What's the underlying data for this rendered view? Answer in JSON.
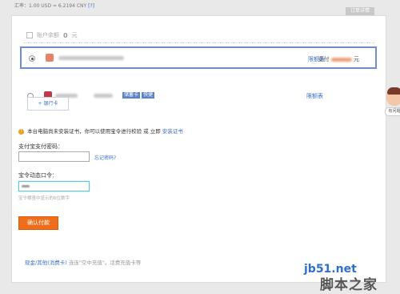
{
  "header": {
    "rate_text": "汇率：1.00 USD = 6.2194 CNY",
    "rate_help": "[?]",
    "order_tab": "订单详情"
  },
  "balance": {
    "label": "账户余额",
    "amount": "0",
    "unit": "元"
  },
  "methods": [
    {
      "selected": true,
      "action": "限额表",
      "pay_label": "支付",
      "pay_unit": "元"
    },
    {
      "selected": false,
      "tags": [
        "储蓄卡",
        "快捷"
      ],
      "action": "限额表"
    }
  ],
  "add_card_label": "+ 银行卡",
  "warning": {
    "text": "本台电脑尚未安装证书，你可以使用宝令进行校验 或 立即",
    "link": "安装证书"
  },
  "password": {
    "label": "支付宝支付密码：",
    "forgot": "忘记密码?"
  },
  "token": {
    "label": "宝令动态口令：",
    "hint": "宝令横竖中显示的6位数字"
  },
  "confirm_label": "确认付款",
  "footer": {
    "prefix": "现金/其他(消费卡)",
    "text": " 连连\"空中充值\"，话费充值卡等"
  },
  "help_label": "有问题",
  "watermark": {
    "site": "jb51.net",
    "brand": "脚本之家"
  },
  "colors": {
    "accent": "#f06e1a",
    "link": "#3b6ec8",
    "selected_border": "#6e8fc6"
  }
}
